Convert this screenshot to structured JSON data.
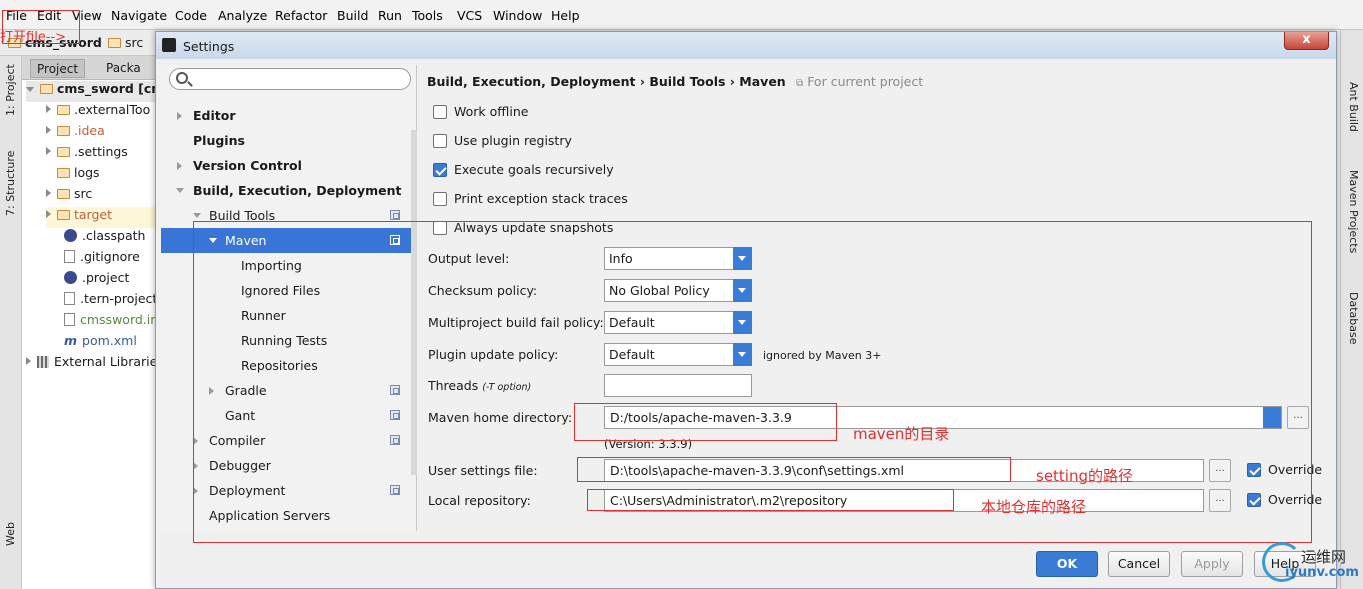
{
  "menu": [
    "File",
    "Edit",
    "View",
    "Navigate",
    "Code",
    "Analyze",
    "Refactor",
    "Build",
    "Run",
    "Tools",
    "VCS",
    "Window",
    "Help"
  ],
  "navbar": {
    "project": "cms_sword",
    "folder": "src"
  },
  "annotation_open_file": "打开file-->",
  "left_strip": {
    "project_tab": "1: Project",
    "structure_tab": "7: Structure",
    "web_tab": "Web"
  },
  "project_panel": {
    "tabs": [
      "Project",
      "Packa"
    ],
    "tree": [
      {
        "label": "cms_sword [cm",
        "bold": true
      },
      {
        "label": ".externalToo"
      },
      {
        "label": ".idea"
      },
      {
        "label": ".settings"
      },
      {
        "label": "logs"
      },
      {
        "label": "src"
      },
      {
        "label": "target"
      },
      {
        "label": ".classpath"
      },
      {
        "label": ".gitignore"
      },
      {
        "label": ".project"
      },
      {
        "label": ".tern-project"
      },
      {
        "label": "cmssword.iml"
      },
      {
        "label": "pom.xml"
      },
      {
        "label": "External Librarie"
      }
    ]
  },
  "right_strip": {
    "tabs": [
      "Ant Build",
      "Maven Projects",
      "Database"
    ]
  },
  "dialog": {
    "title": "Settings",
    "close": "x",
    "search_placeholder": "",
    "nav": [
      "Editor",
      "Plugins",
      "Version Control",
      "Build, Execution, Deployment",
      "Build Tools",
      "Maven",
      "Importing",
      "Ignored Files",
      "Runner",
      "Running Tests",
      "Repositories",
      "Gradle",
      "Gant",
      "Compiler",
      "Debugger",
      "Deployment",
      "Application Servers"
    ],
    "breadcrumb": {
      "part1": "Build, Execution, Deployment",
      "sep": "›",
      "part2": "Build Tools",
      "part3": "Maven",
      "scope": "For current project"
    },
    "checkboxes": {
      "work_offline": "Work offline",
      "plugin_registry": "Use plugin registry",
      "execute_goals": "Execute goals recursively",
      "print_traces": "Print exception stack traces",
      "always_update": "Always update snapshots"
    },
    "fields": {
      "output_level_label": "Output level:",
      "output_level": "Info",
      "checksum_label": "Checksum policy:",
      "checksum": "No Global Policy",
      "multiproject_label": "Multiproject build fail policy:",
      "multiproject": "Default",
      "plugin_update_label": "Plugin update policy:",
      "plugin_update": "Default",
      "plugin_update_note": "ignored by Maven 3+",
      "threads_label": "Threads",
      "threads_hint": "(-T option)",
      "threads": "",
      "home_label": "Maven home directory:",
      "home": "D:/tools/apache-maven-3.3.9",
      "version": "(Version: 3.3.9)",
      "user_settings_label": "User settings file:",
      "user_settings": "D:\\tools\\apache-maven-3.3.9\\conf\\settings.xml",
      "local_repo_label": "Local repository:",
      "local_repo": "C:\\Users\\Administrator\\.m2\\repository",
      "override": "Override",
      "browse": "..."
    },
    "annotations": {
      "home": "maven的目录",
      "settings": "setting的路径",
      "repo": "本地仓库的路径"
    },
    "buttons": {
      "ok": "OK",
      "cancel": "Cancel",
      "apply": "Apply",
      "help": "Help"
    }
  },
  "watermark": {
    "cn": "运维网",
    "url": "iyunv.com"
  }
}
